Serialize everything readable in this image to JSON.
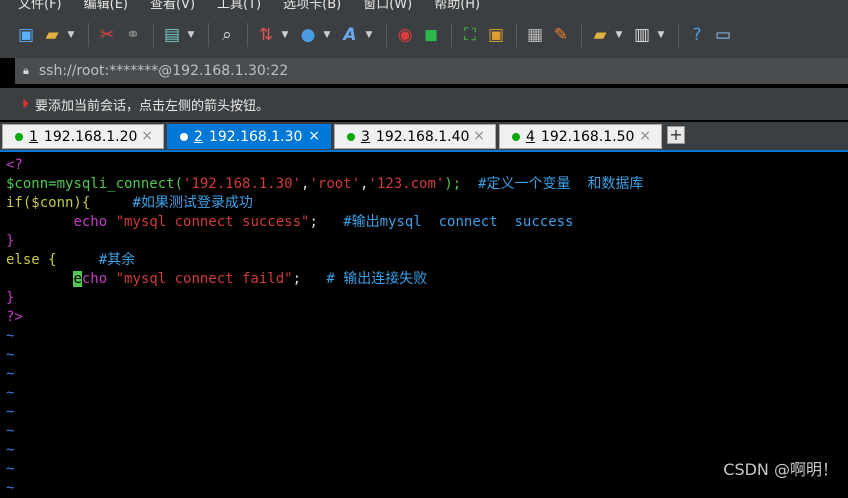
{
  "menu": [
    "文件(F)",
    "编辑(E)",
    "查看(V)",
    "工具(T)",
    "选项卡(B)",
    "窗口(W)",
    "帮助(H)"
  ],
  "toolbar_icons": [
    "new-session-icon",
    "open-folder-icon",
    "disconnect-icon",
    "reconnect-icon",
    "new-file-icon",
    "search-icon",
    "transfer-icon",
    "globe-icon",
    "font-icon",
    "xshell-icon",
    "xftp-icon",
    "fullscreen-icon",
    "lock-icon",
    "keyboard-icon",
    "highlight-icon",
    "new-folder-icon",
    "layout-icon",
    "help-icon",
    "chat-icon"
  ],
  "address": {
    "text": "ssh://root:*******@192.168.1.30:22"
  },
  "hint": {
    "text": "要添加当前会话，点击左侧的箭头按钮。"
  },
  "tabs": [
    {
      "num": "1",
      "label": "192.168.1.20",
      "active": false
    },
    {
      "num": "2",
      "label": "192.168.1.30",
      "active": true
    },
    {
      "num": "3",
      "label": "192.168.1.40",
      "active": false
    },
    {
      "num": "4",
      "label": "192.168.1.50",
      "active": false
    }
  ],
  "tab_close": "×",
  "tab_add": "+",
  "code": {
    "l1": "<?",
    "l2a": "$conn=mysqli_connect(",
    "l2b": "'192.168.1.30'",
    "l2c": ",",
    "l2d": "'root'",
    "l2e": ",",
    "l2f": "'123.com'",
    "l2g": ");",
    "l2h": "  #定义一个变量  和数据库",
    "l3a": "if($conn){",
    "l3b": "     #如果测试登录成功",
    "l4a": "echo ",
    "l4b": "\"mysql connect success\"",
    "l4c": ";",
    "l4d": "   #输出mysql  connect  success",
    "l5": "}",
    "l6a": "else {",
    "l6b": "     #其余",
    "l7a": "e",
    "l7b": "cho ",
    "l7c": "\"mysql connect faild\"",
    "l7d": ";",
    "l7e": "   # 输出连接失败",
    "l8": "}",
    "l9": "?>",
    "tilde": "~"
  },
  "watermark": "CSDN @啊明！"
}
